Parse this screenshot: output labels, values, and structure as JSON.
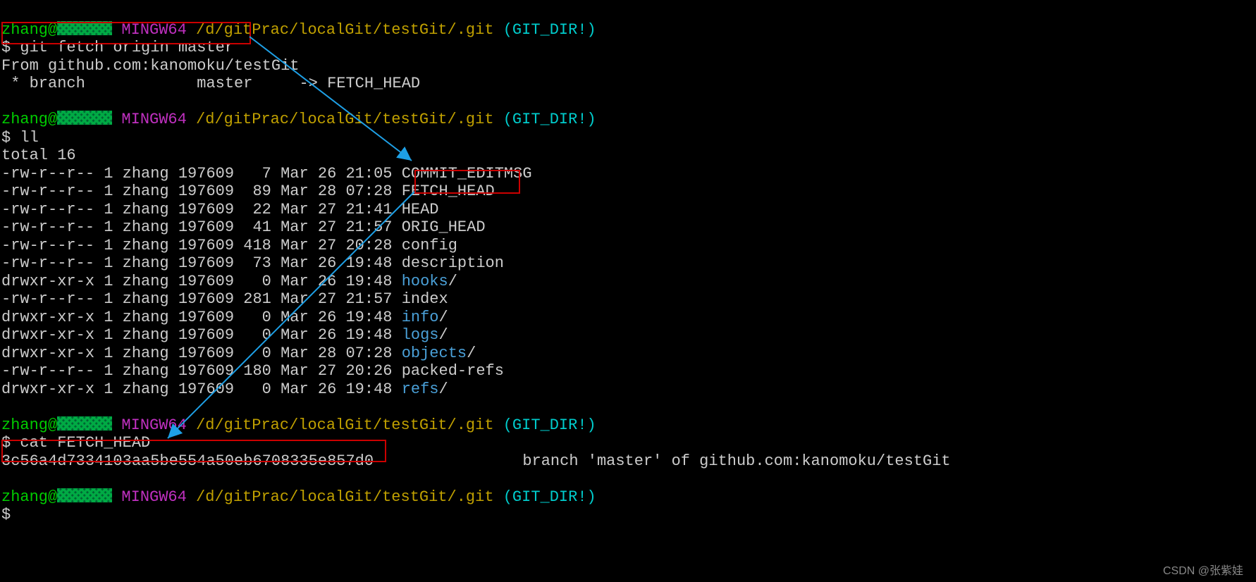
{
  "prompt": {
    "user": "zhang",
    "at": "@",
    "mingw": "MINGW64",
    "path": "/d/gitPrac/localGit/testGit/.git",
    "gitdir": "(GIT_DIR!)",
    "dollar": "$"
  },
  "cmds": {
    "fetch": "git fetch origin master",
    "ll": "ll",
    "cat": "cat FETCH_HEAD"
  },
  "fetch_out": {
    "from": "From github.com:kanomoku/testGit",
    "branch_line_pre": " * branch            master     -> ",
    "branch_line_head": "FETCH_HEAD"
  },
  "ll_out": {
    "total": "total 16",
    "rows": [
      {
        "perm": "-rw-r--r--",
        "n": "1",
        "usr": "zhang",
        "grp": "197609",
        "sz": "  7",
        "mon": "Mar",
        "day": "26",
        "time": "21:05",
        "name": "COMMIT_EDITMSG",
        "dir": false
      },
      {
        "perm": "-rw-r--r--",
        "n": "1",
        "usr": "zhang",
        "grp": "197609",
        "sz": " 89",
        "mon": "Mar",
        "day": "28",
        "time": "07:28",
        "name": "FETCH_HEAD",
        "dir": false
      },
      {
        "perm": "-rw-r--r--",
        "n": "1",
        "usr": "zhang",
        "grp": "197609",
        "sz": " 22",
        "mon": "Mar",
        "day": "27",
        "time": "21:41",
        "name": "HEAD",
        "dir": false
      },
      {
        "perm": "-rw-r--r--",
        "n": "1",
        "usr": "zhang",
        "grp": "197609",
        "sz": " 41",
        "mon": "Mar",
        "day": "27",
        "time": "21:57",
        "name": "ORIG_HEAD",
        "dir": false
      },
      {
        "perm": "-rw-r--r--",
        "n": "1",
        "usr": "zhang",
        "grp": "197609",
        "sz": "418",
        "mon": "Mar",
        "day": "27",
        "time": "20:28",
        "name": "config",
        "dir": false
      },
      {
        "perm": "-rw-r--r--",
        "n": "1",
        "usr": "zhang",
        "grp": "197609",
        "sz": " 73",
        "mon": "Mar",
        "day": "26",
        "time": "19:48",
        "name": "description",
        "dir": false
      },
      {
        "perm": "drwxr-xr-x",
        "n": "1",
        "usr": "zhang",
        "grp": "197609",
        "sz": "  0",
        "mon": "Mar",
        "day": "26",
        "time": "19:48",
        "name": "hooks",
        "dir": true
      },
      {
        "perm": "-rw-r--r--",
        "n": "1",
        "usr": "zhang",
        "grp": "197609",
        "sz": "281",
        "mon": "Mar",
        "day": "27",
        "time": "21:57",
        "name": "index",
        "dir": false
      },
      {
        "perm": "drwxr-xr-x",
        "n": "1",
        "usr": "zhang",
        "grp": "197609",
        "sz": "  0",
        "mon": "Mar",
        "day": "26",
        "time": "19:48",
        "name": "info",
        "dir": true
      },
      {
        "perm": "drwxr-xr-x",
        "n": "1",
        "usr": "zhang",
        "grp": "197609",
        "sz": "  0",
        "mon": "Mar",
        "day": "26",
        "time": "19:48",
        "name": "logs",
        "dir": true
      },
      {
        "perm": "drwxr-xr-x",
        "n": "1",
        "usr": "zhang",
        "grp": "197609",
        "sz": "  0",
        "mon": "Mar",
        "day": "28",
        "time": "07:28",
        "name": "objects",
        "dir": true
      },
      {
        "perm": "-rw-r--r--",
        "n": "1",
        "usr": "zhang",
        "grp": "197609",
        "sz": "180",
        "mon": "Mar",
        "day": "27",
        "time": "20:26",
        "name": "packed-refs",
        "dir": false
      },
      {
        "perm": "drwxr-xr-x",
        "n": "1",
        "usr": "zhang",
        "grp": "197609",
        "sz": "  0",
        "mon": "Mar",
        "day": "26",
        "time": "19:48",
        "name": "refs",
        "dir": true
      }
    ]
  },
  "cat_out": {
    "hash": "3c56a4d7334103aa5be554a50eb6708335e857d0",
    "gap": "                ",
    "rest": "branch 'master' of github.com:kanomoku/testGit"
  },
  "watermark": "CSDN @张紫娃"
}
